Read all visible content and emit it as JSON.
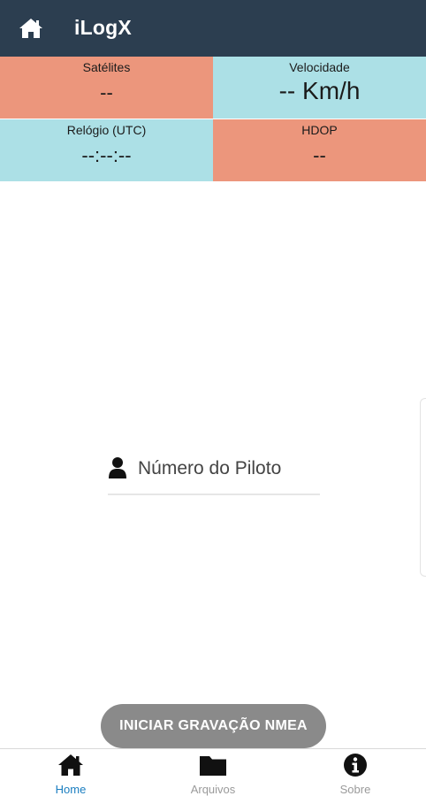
{
  "app": {
    "title": "iLogX"
  },
  "stats": {
    "satellites": {
      "label": "Satélites",
      "value": "--"
    },
    "speed": {
      "label": "Velocidade",
      "value": "-- Km/h"
    },
    "clock": {
      "label": "Relógio (UTC)",
      "value": "--:--:--"
    },
    "hdop": {
      "label": "HDOP",
      "value": "--"
    }
  },
  "pilot": {
    "placeholder": "Número do Piloto",
    "value": ""
  },
  "record_button": {
    "label": "INICIAR GRAVAÇÃO NMEA"
  },
  "nav": {
    "items": [
      {
        "label": "Home",
        "icon": "home-icon",
        "active": true
      },
      {
        "label": "Arquivos",
        "icon": "folder-icon",
        "active": false
      },
      {
        "label": "Sobre",
        "icon": "info-icon",
        "active": false
      }
    ]
  },
  "colors": {
    "topbar": "#2c3e50",
    "salmon": "#ec967c",
    "cyan": "#ace0e6",
    "active_nav": "#1a7ec0",
    "button": "#8a8a8a"
  }
}
